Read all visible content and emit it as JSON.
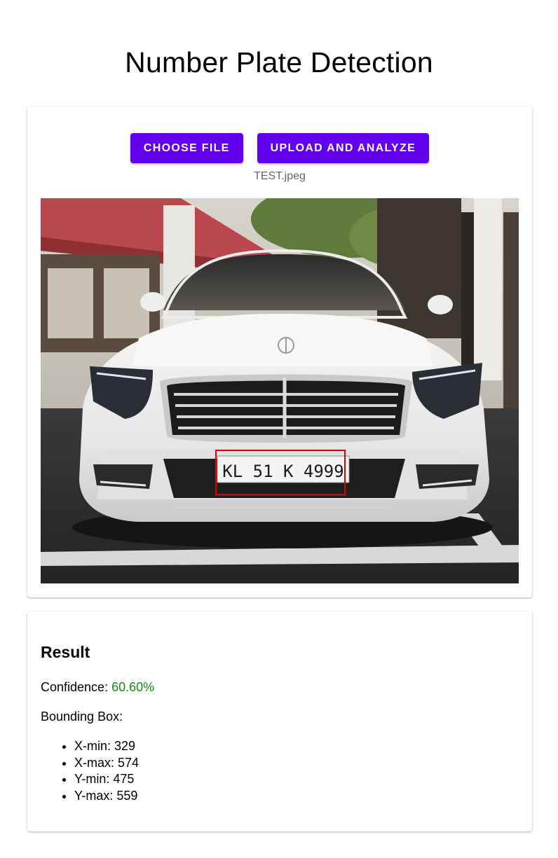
{
  "page": {
    "title": "Number Plate Detection"
  },
  "upload": {
    "choose_label": "CHOOSE FILE",
    "analyze_label": "UPLOAD AND ANALYZE",
    "filename": "TEST.jpeg",
    "image_plate_text": "KL 51  K  4999"
  },
  "result": {
    "title": "Result",
    "confidence_label": "Confidence:",
    "confidence_value": "60.60%",
    "bbox_label": "Bounding Box:",
    "bbox_items": [
      "X-min: 329",
      "X-max: 574",
      "Y-min: 475",
      "Y-max: 559"
    ]
  },
  "colors": {
    "accent": "#6200ee",
    "confidence": "#138a13",
    "bbox": "#e00000"
  }
}
